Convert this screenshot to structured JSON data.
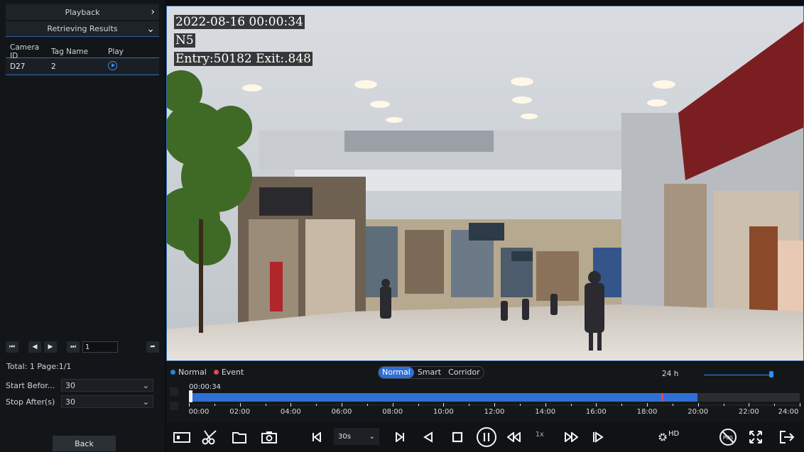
{
  "left_panel": {
    "playback_label": "Playback",
    "results_label": "Retrieving Results",
    "table": {
      "headers": [
        "Camera ID",
        "Tag Name",
        "Play"
      ],
      "rows": [
        {
          "camera_id": "D27",
          "tag_name": "2"
        }
      ]
    },
    "pager": {
      "first": "⏮",
      "prev": "◀",
      "next": "▶",
      "last": "⏭",
      "page_input": "1",
      "go": "➦"
    },
    "total_text": "Total: 1  Page:1/1",
    "start_before": {
      "label": "Start Befor...",
      "value": "30"
    },
    "stop_after": {
      "label": "Stop After(s)",
      "value": "30"
    },
    "back_label": "Back"
  },
  "video": {
    "timestamp": "2022-08-16 00:00:34",
    "channel": "N5",
    "counter": "Entry:50182 Exit:.848"
  },
  "timeline": {
    "legend": [
      {
        "label": "Normal",
        "color": "#2f7fe0"
      },
      {
        "label": "Event",
        "color": "#e0485a"
      }
    ],
    "modes": [
      "Normal",
      "Smart",
      "Corridor"
    ],
    "active_mode": "Normal",
    "zoom_label": "24 h",
    "current_time": "00:00:34",
    "tick_labels": [
      "00:00",
      "02:00",
      "04:00",
      "06:00",
      "08:00",
      "10:00",
      "12:00",
      "14:00",
      "16:00",
      "18:00",
      "20:00",
      "22:00",
      "24:00"
    ],
    "recorded_until_fraction": 0.833,
    "event_position_fraction": 0.773,
    "cursor_fraction": 0.0
  },
  "controls": {
    "speed_value": "30s",
    "playback_speed": "1x",
    "quality": "HD"
  },
  "colors": {
    "accent": "#2f6fd6",
    "event": "#e0485a",
    "panel": "#131619"
  }
}
